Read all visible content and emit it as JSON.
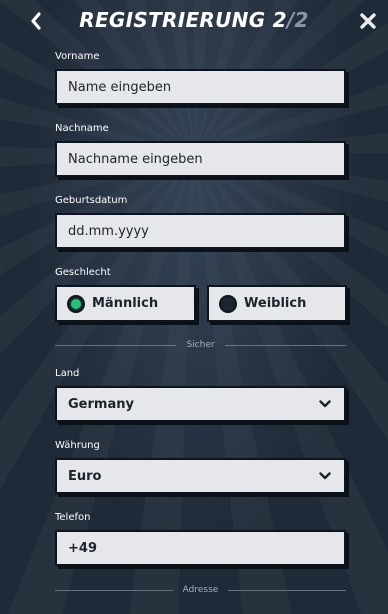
{
  "header": {
    "title_main": "REGISTRIERUNG 2",
    "title_slash": "/2"
  },
  "form": {
    "first_name": {
      "label": "Vorname",
      "placeholder": "Name eingeben"
    },
    "last_name": {
      "label": "Nachname",
      "placeholder": "Nachname eingeben"
    },
    "birthdate": {
      "label": "Geburtsdatum",
      "placeholder": "dd.mm.yyyy"
    },
    "gender": {
      "label": "Geschlecht",
      "options": [
        {
          "label": "Männlich",
          "selected": true
        },
        {
          "label": "Weiblich",
          "selected": false
        }
      ],
      "accent": "#22c27a"
    },
    "section_secure": "Sicher",
    "country": {
      "label": "Land",
      "value": "Germany"
    },
    "currency": {
      "label": "Währung",
      "value": "Euro"
    },
    "phone": {
      "label": "Telefon",
      "value": "+49"
    },
    "section_address": "Adresse"
  },
  "icons": {
    "back": "chevron-left-icon",
    "close": "close-icon",
    "dropdown": "chevron-down-icon"
  }
}
